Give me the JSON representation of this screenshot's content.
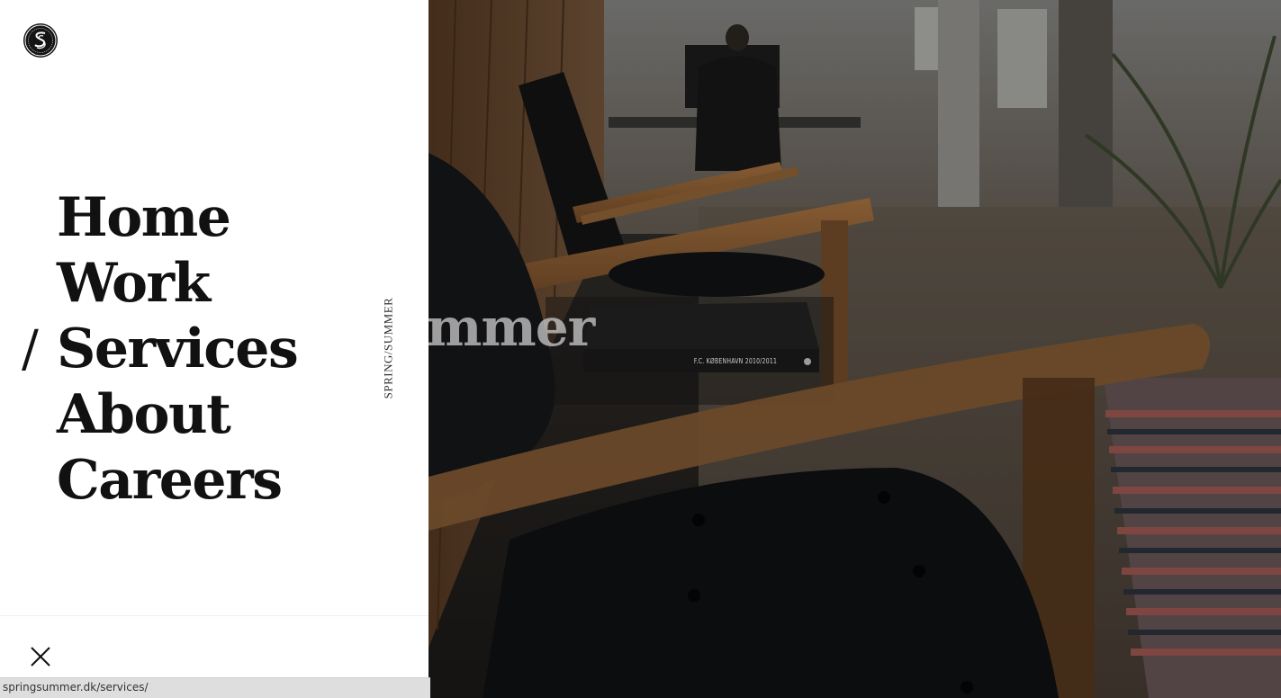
{
  "nav": {
    "active_marker": "/",
    "items": [
      "Home",
      "Work",
      "Services",
      "About",
      "Careers"
    ]
  },
  "side_label": "SPRING/SUMMER",
  "hero": {
    "brand_word": "mmer",
    "book_label": "F.C. KØBENHAVN 2010/2011"
  },
  "status_bar": {
    "url": "springsummer.dk/services/"
  },
  "icons": {
    "logo": "ss-monogram-logo",
    "close": "close-icon"
  },
  "colors": {
    "panel_bg": "#ffffff",
    "text": "#111111",
    "photo_overlay": "#1a1a1a"
  }
}
